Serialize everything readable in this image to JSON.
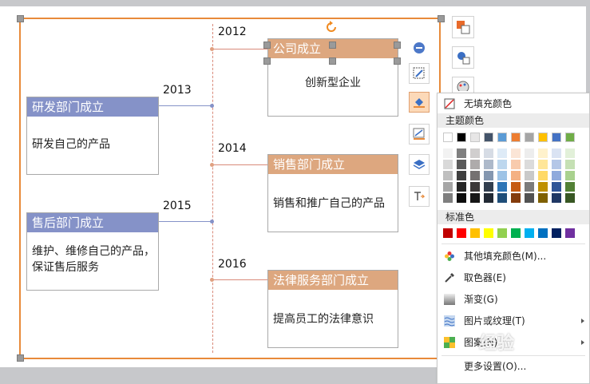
{
  "years": [
    "2012",
    "2013",
    "2014",
    "2015",
    "2016"
  ],
  "events": {
    "e2012": {
      "title": "公司成立",
      "desc": "创新型企业"
    },
    "e2013": {
      "title": "研发部门成立",
      "desc": "研发自己的产品"
    },
    "e2014": {
      "title": "销售部门成立",
      "desc": "销售和推广自己的产品"
    },
    "e2015": {
      "title": "售后部门成立",
      "desc_line1": "维护、维修自己的产品，",
      "desc_line2": "保证售后服务"
    },
    "e2016": {
      "title": "法律服务部门成立",
      "desc": "提高员工的法律意识"
    }
  },
  "colors": {
    "frame": "#e88a3a",
    "header_blue": "#8592c8",
    "header_orange": "#dda77f",
    "timeline": "#d98a7a"
  },
  "toolbar_icons": [
    "shape-style-icon",
    "outline-icon",
    "fill-icon",
    "line-color-icon",
    "layers-icon",
    "text-wrap-icon"
  ],
  "fill_menu": {
    "no_fill": "无填充颜色",
    "theme_colors": "主题颜色",
    "standard_colors": "标准色",
    "more_fill": "其他填充颜色(M)...",
    "eyedropper": "取色器(E)",
    "gradient": "渐变(G)",
    "picture_texture": "图片或纹理(T)",
    "pattern": "图案(N)",
    "more_settings": "更多设置(O)...",
    "theme_top": [
      "#ffffff",
      "#000000",
      "#e7e6e6",
      "#44546a",
      "#5b9bd5",
      "#ed7d31",
      "#a5a5a5",
      "#ffc000",
      "#4472c4",
      "#70ad47"
    ],
    "theme_shades": [
      [
        "#f2f2f2",
        "#7f7f7f",
        "#d0cece",
        "#d6dce5",
        "#deebf7",
        "#fbe5d6",
        "#ededed",
        "#fff2cc",
        "#dae3f3",
        "#e2f0d9"
      ],
      [
        "#d9d9d9",
        "#595959",
        "#aeabab",
        "#adb9ca",
        "#bdd7ee",
        "#f8cbad",
        "#dbdbdb",
        "#ffe699",
        "#b4c7e7",
        "#c5e0b4"
      ],
      [
        "#bfbfbf",
        "#3f3f3f",
        "#757171",
        "#8497b0",
        "#9dc3e6",
        "#f4b183",
        "#c9c9c9",
        "#ffd966",
        "#8faadc",
        "#a9d18e"
      ],
      [
        "#a6a6a6",
        "#262626",
        "#3b3838",
        "#323f4f",
        "#2e75b6",
        "#c55a11",
        "#7b7b7b",
        "#bf9000",
        "#2f5597",
        "#538135"
      ],
      [
        "#7f7f7f",
        "#0d0d0d",
        "#171717",
        "#222a35",
        "#1f4e79",
        "#843c0c",
        "#525252",
        "#7f6000",
        "#203864",
        "#385723"
      ]
    ],
    "standard": [
      "#c00000",
      "#ff0000",
      "#ffc000",
      "#ffff00",
      "#92d050",
      "#00b050",
      "#00b0f0",
      "#0070c0",
      "#002060",
      "#7030a0"
    ]
  },
  "watermark": "经验"
}
